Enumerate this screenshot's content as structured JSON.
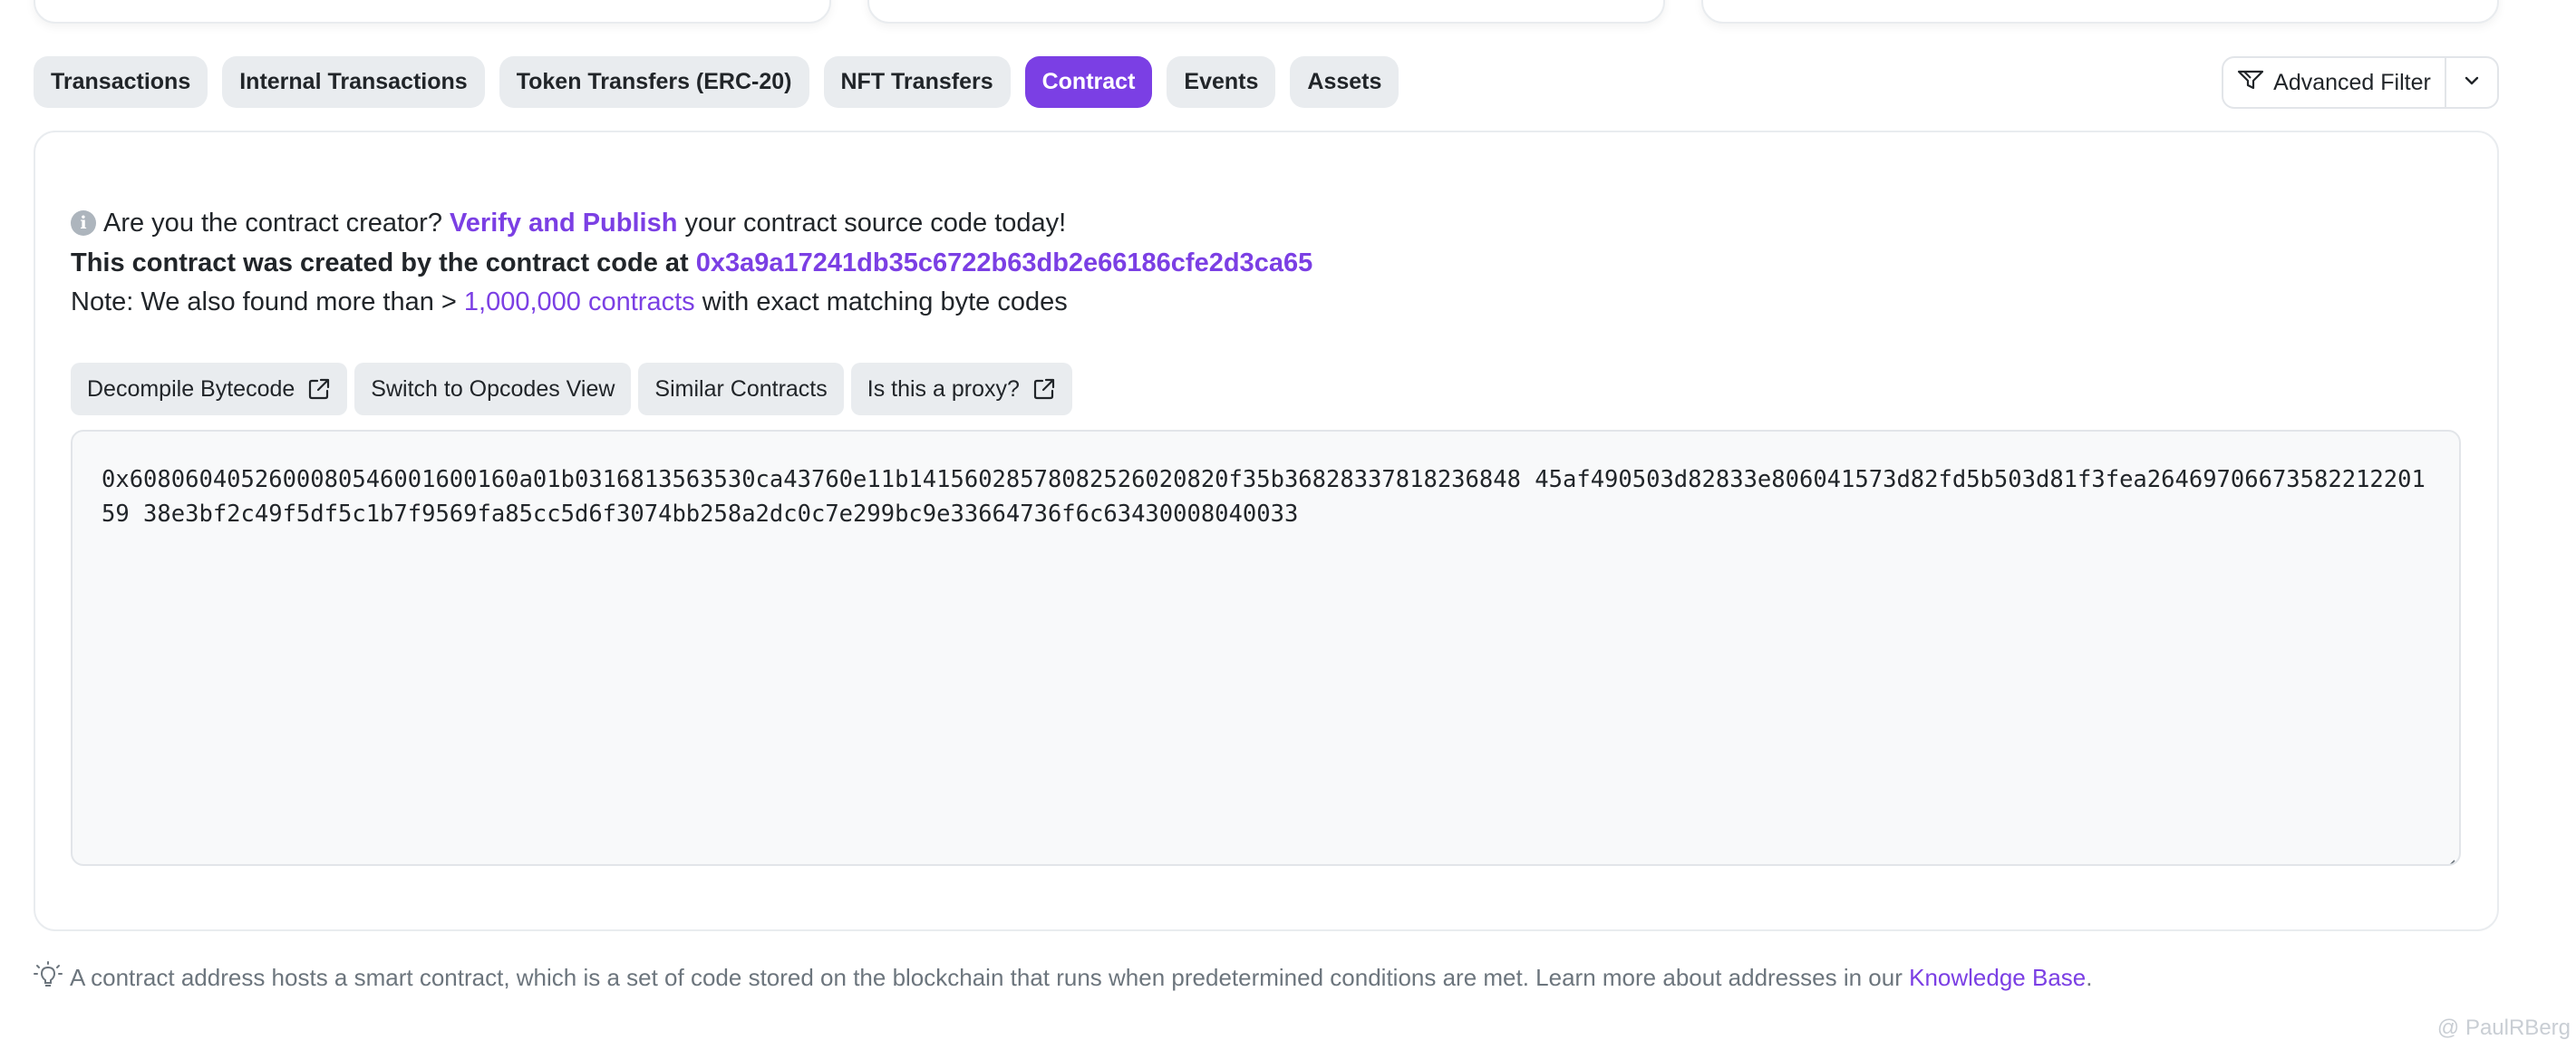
{
  "tabs": [
    {
      "label": "Transactions",
      "active": false
    },
    {
      "label": "Internal Transactions",
      "active": false
    },
    {
      "label": "Token Transfers (ERC-20)",
      "active": false
    },
    {
      "label": "NFT Transfers",
      "active": false
    },
    {
      "label": "Contract",
      "active": true
    },
    {
      "label": "Events",
      "active": false
    },
    {
      "label": "Assets",
      "active": false
    }
  ],
  "advanced_filter": {
    "label": "Advanced Filter",
    "icon": "filter-icon"
  },
  "info": {
    "prefix": "Are you the contract creator?",
    "link": "Verify and Publish",
    "suffix": "your contract source code today!"
  },
  "created": {
    "prefix": "This contract was created by the contract code at",
    "address": "0x3a9a17241db35c6722b63db2e66186cfe2d3ca65"
  },
  "note": {
    "prefix": "Note: We also found more than >",
    "link": "1,000,000 contracts",
    "suffix": "with exact matching byte codes"
  },
  "actions": [
    {
      "label": "Decompile Bytecode",
      "external": true
    },
    {
      "label": "Switch to Opcodes View",
      "external": false
    },
    {
      "label": "Similar Contracts",
      "external": false
    },
    {
      "label": "Is this a proxy?",
      "external": true
    }
  ],
  "bytecode": "0x6080604052600080546001600160a01b0316813563530ca43760e11b14156028578082526020820f35b36828337818236848 45af490503d82833e806041573d82fd5b503d81f3fea2646970667358221220159 38e3bf2c49f5df5c1b7f9569fa85cc5d6f3074bb258a2dc0c7e299bc9e33664736f6c63430008040033",
  "footer": {
    "text": "A contract address hosts a smart contract, which is a set of code stored on the blockchain that runs when predetermined conditions are met. Learn more about addresses in our",
    "link": "Knowledge Base",
    "end": "."
  },
  "watermark": "@ PaulRBerg",
  "colors": {
    "accent": "#7b3fe4",
    "tab_bg": "#e9ecef",
    "muted": "#6c757d"
  }
}
